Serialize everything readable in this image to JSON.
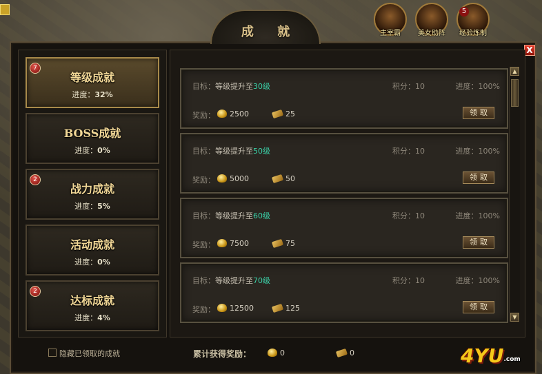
{
  "window": {
    "title": "成 就",
    "close_label": "X"
  },
  "top_icons": [
    {
      "label": "主宰霸",
      "badge": ""
    },
    {
      "label": "美女助阵",
      "badge": ""
    },
    {
      "label": "经验炼制",
      "badge": "5"
    }
  ],
  "categories": [
    {
      "name": "等级成就",
      "progress_label": "进度：",
      "progress": "32%",
      "badge": "7",
      "active": true
    },
    {
      "name": "BOSS成就",
      "progress_label": "进度：",
      "progress": "0%",
      "badge": "",
      "active": false
    },
    {
      "name": "战力成就",
      "progress_label": "进度：",
      "progress": "5%",
      "badge": "2",
      "active": false
    },
    {
      "name": "活动成就",
      "progress_label": "进度：",
      "progress": "0%",
      "badge": "",
      "active": false
    },
    {
      "name": "达标成就",
      "progress_label": "进度：",
      "progress": "4%",
      "badge": "2",
      "active": false
    }
  ],
  "achievements": [
    {
      "goal_label": "目标：",
      "goal_text": "等级提升至",
      "level": "30级",
      "score_label": "积分：",
      "score": "10",
      "progress_label": "进度：",
      "progress": "100%",
      "reward_label": "奖励：",
      "gold": "2500",
      "ticket": "25",
      "claim_label": "领取"
    },
    {
      "goal_label": "目标：",
      "goal_text": "等级提升至",
      "level": "50级",
      "score_label": "积分：",
      "score": "10",
      "progress_label": "进度：",
      "progress": "100%",
      "reward_label": "奖励：",
      "gold": "5000",
      "ticket": "50",
      "claim_label": "领取"
    },
    {
      "goal_label": "目标：",
      "goal_text": "等级提升至",
      "level": "60级",
      "score_label": "积分：",
      "score": "10",
      "progress_label": "进度：",
      "progress": "100%",
      "reward_label": "奖励：",
      "gold": "7500",
      "ticket": "75",
      "claim_label": "领取"
    },
    {
      "goal_label": "目标：",
      "goal_text": "等级提升至",
      "level": "70级",
      "score_label": "积分：",
      "score": "10",
      "progress_label": "进度：",
      "progress": "100%",
      "reward_label": "奖励：",
      "gold": "12500",
      "ticket": "125",
      "claim_label": "领取"
    }
  ],
  "footer": {
    "hide_claimed_label": "隐藏已领取的成就",
    "total_label": "累计获得奖励：",
    "total_gold": "0",
    "total_ticket": "0"
  },
  "logo": {
    "text": "4YU",
    "suffix": ".com"
  },
  "icons": {
    "gold": "gold-coin-icon",
    "ticket": "ticket-icon",
    "close": "close-icon",
    "scroll_up": "scroll-up-icon",
    "scroll_down": "scroll-down-icon"
  },
  "colors": {
    "level_highlight": "#3bd1a8",
    "title_gold": "#f1d796",
    "badge_red": "#8a1010"
  }
}
